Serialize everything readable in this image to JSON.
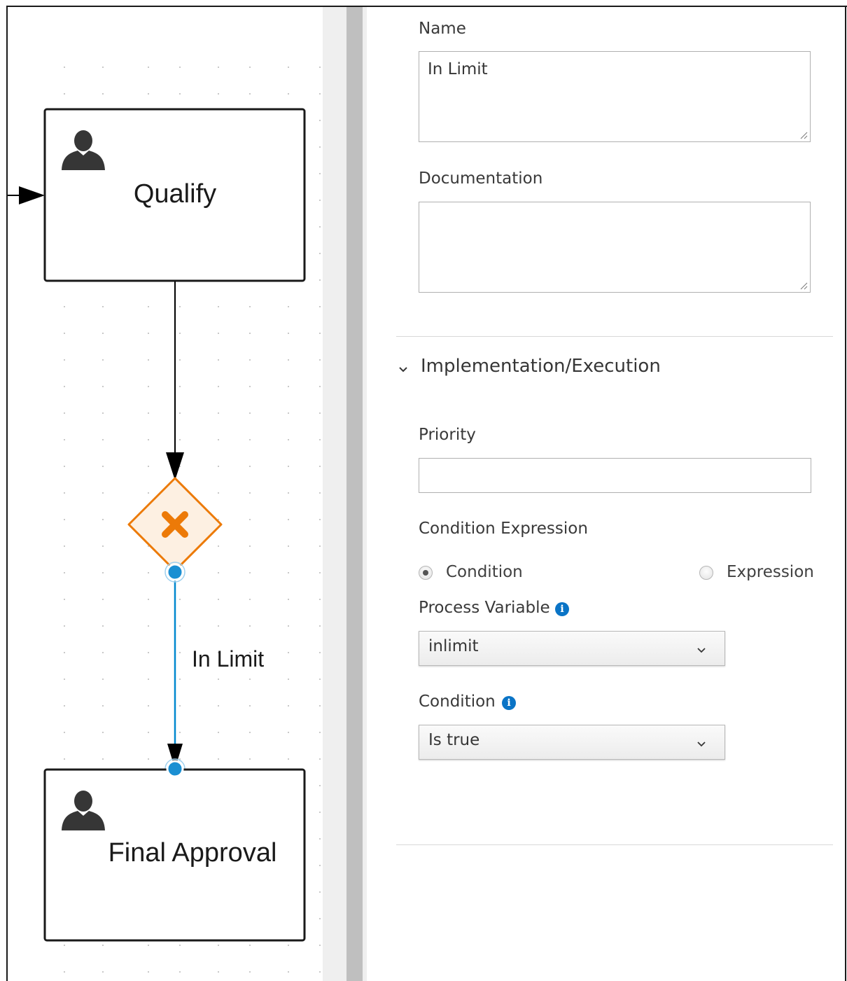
{
  "diagram": {
    "task_top_label": "Qualify",
    "task_bottom_label": "Final Approval",
    "flow_label": "In Limit",
    "gateway_accent_color": "#ec7a08",
    "selected_flow_color": "#0088ce"
  },
  "properties": {
    "name_label": "Name",
    "name_value": "In Limit",
    "documentation_label": "Documentation",
    "documentation_value": "",
    "section_title": "Implementation/Execution",
    "priority_label": "Priority",
    "priority_value": "",
    "condition_expression_label": "Condition Expression",
    "radio_condition_label": "Condition",
    "radio_expression_label": "Expression",
    "process_variable_label": "Process Variable",
    "process_variable_value": "inlimit",
    "condition_label": "Condition",
    "condition_value": "Is true",
    "info_icon_color": "#0a74c6"
  }
}
